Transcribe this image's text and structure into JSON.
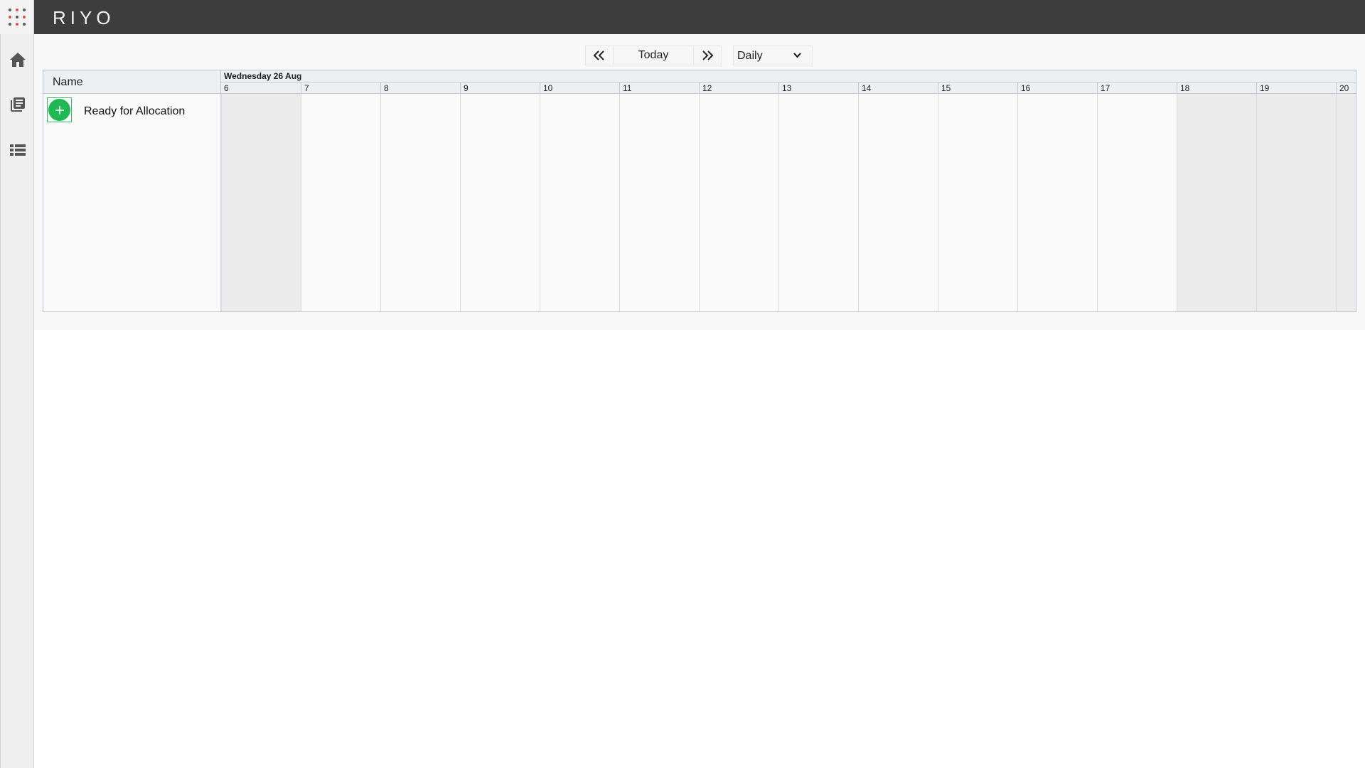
{
  "app": {
    "title": "RIYO"
  },
  "launcher": {
    "icon": "apps-grid-icon"
  },
  "sidebar": {
    "items": [
      {
        "name": "home",
        "icon": "home-icon"
      },
      {
        "name": "library",
        "icon": "library-books-icon"
      },
      {
        "name": "list",
        "icon": "view-list-icon"
      }
    ]
  },
  "toolbar": {
    "prev_icon": "double-chevron-left-icon",
    "today_label": "Today",
    "next_icon": "double-chevron-right-icon",
    "period_value": "Daily",
    "period_options": [
      "Daily"
    ]
  },
  "scheduler": {
    "name_header": "Name",
    "date_label": "Wednesday 26 Aug",
    "hours": [
      "6",
      "7",
      "8",
      "9",
      "10",
      "11",
      "12",
      "13",
      "14",
      "15",
      "16",
      "17",
      "18",
      "19",
      "20"
    ],
    "shaded_hours": [
      "6",
      "18",
      "19",
      "20"
    ],
    "resources": [
      {
        "label": "Ready for Allocation",
        "add_icon": "plus-icon"
      }
    ]
  },
  "colors": {
    "topbar": "#3d3d3d",
    "accent_green": "#1fb954",
    "grid_border": "#b9c3cf",
    "shaded_column": "#ececec"
  }
}
